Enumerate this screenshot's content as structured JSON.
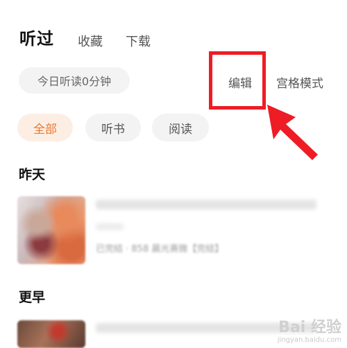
{
  "tabs": {
    "active": "听过",
    "favorites": "收藏",
    "downloads": "下载"
  },
  "reading_time": "今日听读0分钟",
  "actions": {
    "edit": "编辑",
    "grid_mode": "宫格模式"
  },
  "filters": {
    "all": "全部",
    "listen": "听书",
    "read": "阅读"
  },
  "sections": {
    "yesterday": "昨天",
    "earlier": "更早"
  },
  "books": [
    {
      "meta": "已完结 · 858 晨光熹微【完结】"
    }
  ],
  "watermark": {
    "brand": "Bai 经验",
    "url": "jingyan.baidu.com"
  },
  "colors": {
    "accent": "#e8782f",
    "chip_active_bg": "#fdeee4",
    "highlight": "#ee1c25"
  }
}
